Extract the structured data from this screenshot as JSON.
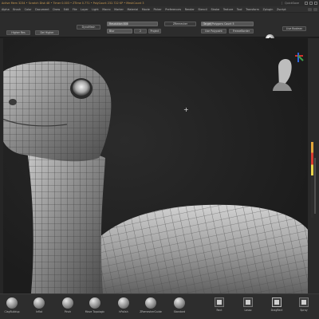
{
  "titlebar": {
    "info": "Active Mem 3234 • Scratch Disk 48 • Timer 0.003 • ZTime 0.771 • PolyCount 232.722 KP • MeshCount 3",
    "quicksave": "QuickSave"
  },
  "menu": [
    "Alpha",
    "Brush",
    "Color",
    "Document",
    "Draw",
    "Edit",
    "File",
    "Layer",
    "Light",
    "Macro",
    "Marker",
    "Material",
    "Movie",
    "Picker",
    "Preferences",
    "Render",
    "Stencil",
    "Stroke",
    "Texture",
    "Tool",
    "Transform",
    "Zplugin",
    "Zscript"
  ],
  "toolbar": {
    "lower_button": "Higher Res",
    "higher_button": "Del Higher",
    "divide_button": "DynaMesh",
    "resolution_label": "Resolution 808",
    "blur_label": "Blur",
    "blur_value": "2",
    "project_button": "Project",
    "polish_button": "Polish",
    "remesh_button": "ZRemesher",
    "target_polycount_label": "Target Polygons Count 5",
    "half_button": "Half",
    "adaptive_button": "Adapt",
    "freeze_button": "FreezeBorder",
    "use_polypaint_button": "Use Polypaint",
    "live_boolean_button": "Live Boolean"
  },
  "canvas": {
    "cursor_glyph": "+"
  },
  "brushes": [
    {
      "label": "ClayBuildup",
      "icon": "claybuildup-brush-icon"
    },
    {
      "label": "Inflat",
      "icon": "inflate-brush-icon"
    },
    {
      "label": "Pinch",
      "icon": "pinch-brush-icon"
    },
    {
      "label": "Move Topologic",
      "icon": "move-topological-brush-icon"
    },
    {
      "label": "hPolish",
      "icon": "hpolish-brush-icon"
    },
    {
      "label": "ZRemesherGuide",
      "icon": "zremesher-guide-brush-icon"
    },
    {
      "label": "Standard",
      "icon": "standard-brush-icon"
    }
  ],
  "right_tools": [
    {
      "label": "Rect",
      "icon": "rect-selection-icon"
    },
    {
      "label": "Lasso",
      "icon": "lasso-selection-icon"
    },
    {
      "label": "DragRect",
      "icon": "dragrect-stroke-icon"
    },
    {
      "label": "Spray",
      "icon": "spray-stroke-icon"
    }
  ],
  "colors": {
    "accent_orange": "#c99a52",
    "shelf_strip_red": "#d93b2f",
    "shelf_strip_yellow": "#e9d44c"
  }
}
